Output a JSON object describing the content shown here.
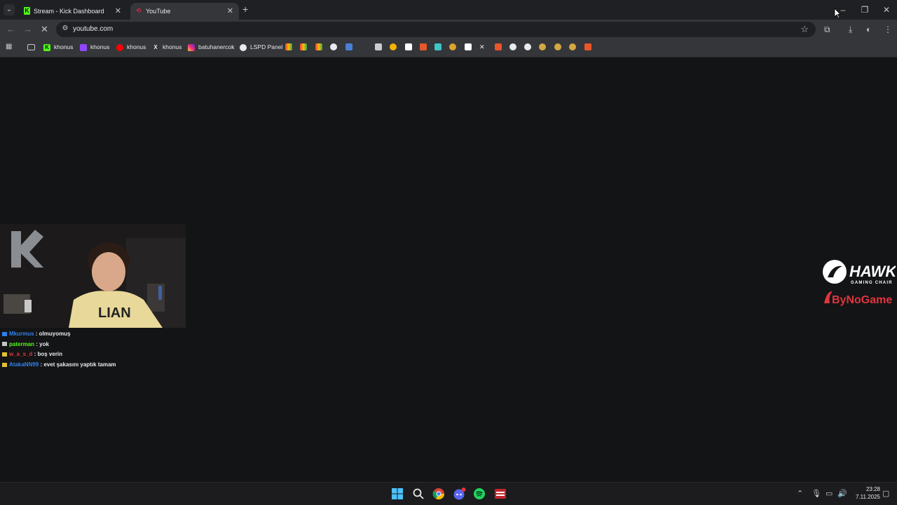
{
  "browser": {
    "tabs": [
      {
        "title": "Stream - Kick Dashboard",
        "active": false
      },
      {
        "title": "YouTube",
        "active": true
      }
    ],
    "new_tab": "+",
    "url": "youtube.com",
    "bookmarks": [
      {
        "label": "khonus",
        "icon": "kick-icon"
      },
      {
        "label": "khonus",
        "icon": "twitch-icon"
      },
      {
        "label": "khonus",
        "icon": "youtube-icon"
      },
      {
        "label": "khonus",
        "icon": "x-icon"
      },
      {
        "label": "batuhanercok",
        "icon": "instagram-icon"
      },
      {
        "label": "LSPD Panel",
        "icon": "lspd-icon"
      }
    ]
  },
  "stream": {
    "chat": [
      {
        "user": "Mkurmus",
        "sep": " : ",
        "message": "olmuyomuş",
        "color": "#2f80ed"
      },
      {
        "user": "paterman",
        "sep": " : ",
        "message": "yok",
        "color": "#53fc18"
      },
      {
        "user": "w_a_s_d",
        "sep": " : ",
        "message": "boş verin",
        "color": "#e0353d"
      },
      {
        "user": "AtakaNN99",
        "sep": " : ",
        "message": "evet şakasını yaptık tamam",
        "color": "#2f80ed"
      }
    ],
    "sponsor": {
      "brand": "HAWK",
      "tagline": "GAMING CHAIR",
      "partner": "ByNoGame"
    }
  },
  "taskbar": {
    "clock_time": "23:28",
    "clock_date": "7.11.2025"
  },
  "colors": {
    "page_bg": "#131416",
    "tabstrip_bg": "#1f2023",
    "toolbar_bg": "#35363a",
    "kick_green": "#53fc18"
  }
}
